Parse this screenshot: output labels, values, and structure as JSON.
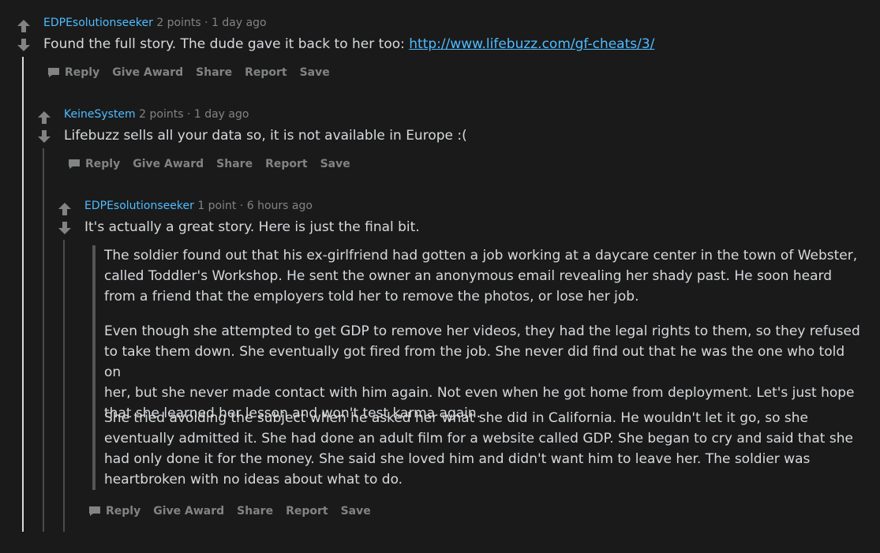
{
  "comments": [
    {
      "user": "EDPEsolutionseeker",
      "points": "2 points",
      "sep": "·",
      "time": "1 day ago",
      "text": "Found the full story. The dude gave it back to her too: ",
      "link": "http://www.lifebuzz.com/gf-cheats/3/"
    },
    {
      "user": "KeineSystem",
      "points": "2 points",
      "sep": "·",
      "time": "1 day ago",
      "text": "Lifebuzz sells all your data so, it is not available in Europe :("
    },
    {
      "user": "EDPEsolutionseeker",
      "points": "1 point",
      "sep": "·",
      "time": "6 hours ago",
      "text": "It's actually a great story. Here is just the final bit.",
      "quote1": [
        "The soldier found out that his ex-girlfriend had gotten a job working at a daycare center in the town of Webster,",
        "called Toddler's Workshop. He sent the owner an anonymous email revealing her shady past. He soon heard",
        "from a friend that the employers told her to remove the photos, or lose her job."
      ],
      "quote1b": [
        "Even though she attempted to get GDP to remove her videos, they had the legal rights to them, so they refused",
        "to take them down. She eventually got fired from the job. She never did find out that he was the one who told on",
        "her, but she never made contact with him again. Not even when he got home from deployment. Let's just hope",
        "that she learned her lesson and won't test karma again."
      ],
      "quote2": [
        "She tried avoiding the subject when he asked her what she did in California. He wouldn't let it go, so she",
        "eventually admitted it. She had done an adult film for a website called GDP. She began to cry and said that she",
        "had only done it for the money. She said she loved him and didn't want him to leave her. The soldier was",
        "heartbroken with no ideas about what to do."
      ]
    }
  ],
  "actions": {
    "reply": "Reply",
    "give_award": "Give Award",
    "share": "Share",
    "report": "Report",
    "save": "Save"
  },
  "colors": {
    "background": "#1a1a1b",
    "username": "#4fbcff",
    "meta": "#818384",
    "text": "#d7dadc",
    "thread_active": "#d7dadc",
    "thread": "#343536"
  },
  "icons": {
    "upvote": "up-arrow-icon",
    "downvote": "down-arrow-icon",
    "reply": "speech-bubble-icon"
  }
}
